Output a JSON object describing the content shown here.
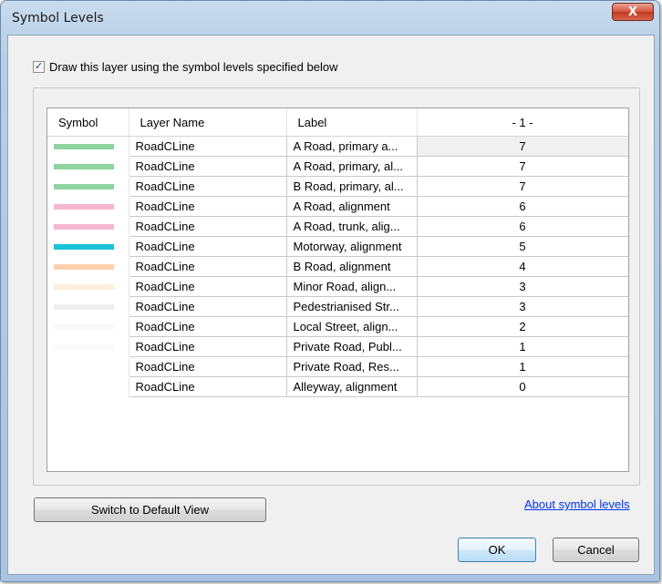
{
  "window": {
    "title": "Symbol Levels",
    "close_glyph": "X"
  },
  "checkbox": {
    "checked": true,
    "check_glyph": "✓",
    "label": "Draw this layer using the symbol levels specified below"
  },
  "table": {
    "columns": [
      "Symbol",
      "Layer Name",
      "Label",
      "- 1 -"
    ],
    "rows": [
      {
        "color": "#8fd3a0",
        "layer": "RoadCLine",
        "label": "A Road, primary a...",
        "level": "7"
      },
      {
        "color": "#8fd3a0",
        "layer": "RoadCLine",
        "label": "A Road, primary, al...",
        "level": "7"
      },
      {
        "color": "#8fd3a0",
        "layer": "RoadCLine",
        "label": "B Road, primary, al...",
        "level": "7"
      },
      {
        "color": "#f7b6cf",
        "layer": "RoadCLine",
        "label": "A Road, alignment",
        "level": "6"
      },
      {
        "color": "#f7b6cf",
        "layer": "RoadCLine",
        "label": "A Road, trunk, alig...",
        "level": "6"
      },
      {
        "color": "#19c3d8",
        "layer": "RoadCLine",
        "label": "Motorway, alignment",
        "level": "5"
      },
      {
        "color": "#fdd0ad",
        "layer": "RoadCLine",
        "label": "B Road, alignment",
        "level": "4"
      },
      {
        "color": "#fdeede",
        "layer": "RoadCLine",
        "label": "Minor Road, align...",
        "level": "3"
      },
      {
        "color": "#efefef",
        "layer": "RoadCLine",
        "label": "Pedestrianised Str...",
        "level": "3"
      },
      {
        "color": "#f8f8f8",
        "layer": "RoadCLine",
        "label": "Local Street, align...",
        "level": "2"
      },
      {
        "color": "#f9f9f9",
        "layer": "RoadCLine",
        "label": "Private Road, Publ...",
        "level": "1"
      },
      {
        "color": "#ffffff",
        "layer": "RoadCLine",
        "label": "Private Road, Res...",
        "level": "1"
      },
      {
        "color": "#ffffff",
        "layer": "RoadCLine",
        "label": "Alleyway, alignment",
        "level": "0"
      }
    ]
  },
  "buttons": {
    "switch_view": "Switch to Default View",
    "ok": "OK",
    "cancel": "Cancel"
  },
  "link": {
    "about": "About symbol levels"
  }
}
